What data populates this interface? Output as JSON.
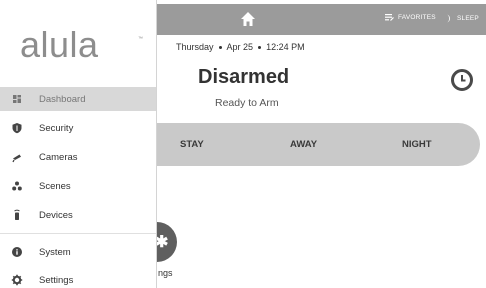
{
  "header": {
    "favorites_label": "FAVORITES",
    "sleep_label": "SLEEP",
    "home_icon": "home-icon",
    "favorites_icon": "favorites-list-icon",
    "sleep_icon": "moon-icon"
  },
  "status": {
    "day": "Thursday",
    "date": "Apr 25",
    "time": "12:24 PM",
    "title": "Disarmed",
    "subtitle": "Ready to Arm"
  },
  "arm_modes": [
    {
      "label": "STAY"
    },
    {
      "label": "AWAY"
    },
    {
      "label": "NIGHT"
    }
  ],
  "shortcut": {
    "label": "ngs"
  },
  "drawer": {
    "logo": "alula",
    "logo_mark": "™",
    "items": [
      {
        "label": "Dashboard",
        "icon": "dashboard-icon",
        "active": true
      },
      {
        "label": "Security",
        "icon": "shield-icon"
      },
      {
        "label": "Cameras",
        "icon": "camera-icon"
      },
      {
        "label": "Scenes",
        "icon": "scenes-icon"
      },
      {
        "label": "Devices",
        "icon": "device-icon"
      },
      {
        "label": "System",
        "icon": "info-icon"
      },
      {
        "label": "Settings",
        "icon": "gear-icon"
      }
    ]
  },
  "colors": {
    "topbar": "#9b9b9b",
    "arm_bar": "#c9c9c9",
    "active_item": "#d8d8d8",
    "logo": "#8d8d8d"
  }
}
